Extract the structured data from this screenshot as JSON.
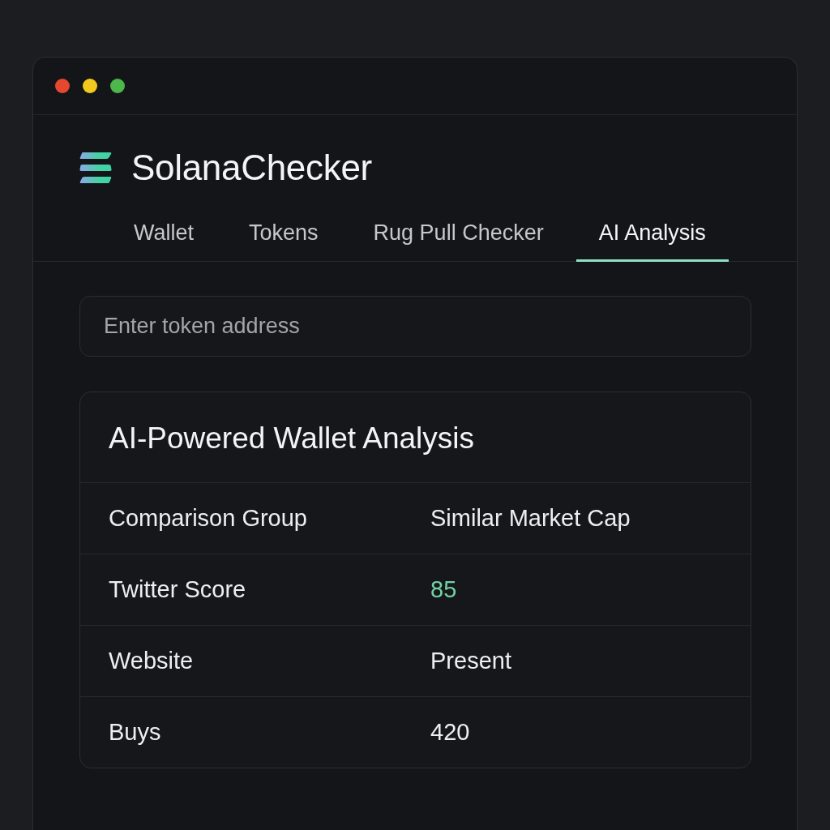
{
  "window": {
    "controls": [
      {
        "color": "#e5482e"
      },
      {
        "color": "#f2c91c"
      },
      {
        "color": "#4cb84c"
      }
    ]
  },
  "app": {
    "title": "SolanaChecker"
  },
  "tabs": [
    {
      "label": "Wallet",
      "selected": false
    },
    {
      "label": "Tokens",
      "selected": false
    },
    {
      "label": "Rug Pull Checker",
      "selected": false
    },
    {
      "label": "AI Analysis",
      "selected": true
    }
  ],
  "search": {
    "placeholder": "Enter token address"
  },
  "analysis": {
    "title": "AI-Powered Wallet Analysis",
    "rows": [
      {
        "label": "Comparison Group",
        "value": "Similar Market Cap"
      },
      {
        "label": "Twitter Score",
        "value": "85",
        "color": "#72d1a4"
      },
      {
        "label": "Website",
        "value": "Present"
      },
      {
        "label": "Buys",
        "value": "420"
      }
    ]
  }
}
